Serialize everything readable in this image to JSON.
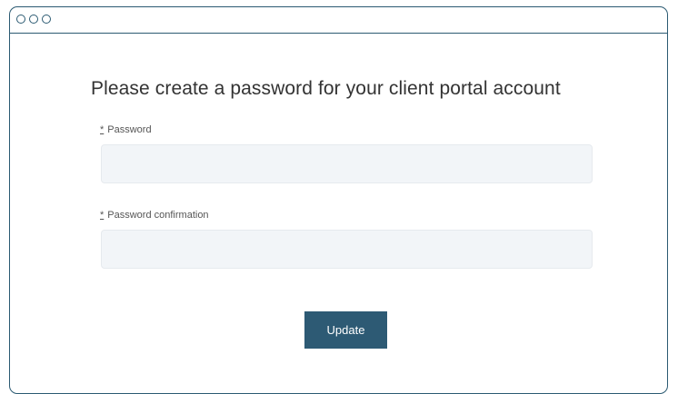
{
  "window": {
    "controls": [
      "dot",
      "dot",
      "dot"
    ],
    "accent_color": "#2b5a72"
  },
  "form": {
    "title": "Please create a password for your client portal account",
    "password_field": {
      "required_marker": "*",
      "label": "Password",
      "value": ""
    },
    "password_confirmation_field": {
      "required_marker": "*",
      "label": "Password confirmation",
      "value": ""
    },
    "submit_label": "Update",
    "button_color": "#2d5a74"
  }
}
